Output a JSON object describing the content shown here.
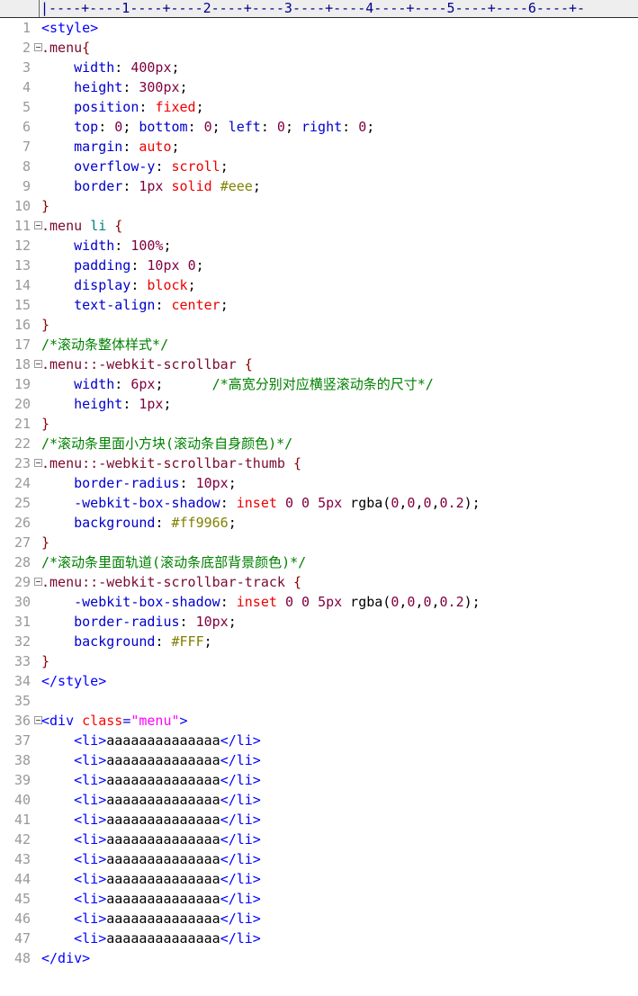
{
  "editor": {
    "type": "code-editor",
    "language": "html-css",
    "total_lines": 48,
    "font": "monospace",
    "background": "#ffffff",
    "gutter_background": "#ffffff",
    "linenumber_color": "#999999",
    "ruler_background": "#eeeeee"
  },
  "ruler": {
    "label": "column-ruler",
    "ticks": "|----+----1----+----2----+----3----+----4----+----5----+----6----+-",
    "markers": [
      "1",
      "2",
      "3",
      "4",
      "5",
      "6"
    ],
    "column_unit": 10
  },
  "colors": {
    "tag": "#0000ff",
    "attribute": "#ff0000",
    "string": "#ff00ff",
    "selector": "#7a0a2e",
    "element_selector": "#008080",
    "brace": "#8b0000",
    "property": "#0000cc",
    "keyword_value": "#ee0000",
    "number": "#800040",
    "hex_color": "#808000",
    "punctuation": "#000000",
    "comment": "#008000",
    "plain_text": "#000000"
  },
  "lines": [
    {
      "n": 1,
      "fold": false,
      "tokens": [
        {
          "c": "t-tag",
          "t": "<style>"
        }
      ]
    },
    {
      "n": 2,
      "fold": true,
      "tokens": [
        {
          "c": "t-sel",
          "t": ".menu"
        },
        {
          "c": "t-brace",
          "t": "{"
        }
      ]
    },
    {
      "n": 3,
      "fold": false,
      "tokens": [
        {
          "c": "t-text",
          "t": "    "
        },
        {
          "c": "t-prop",
          "t": "width"
        },
        {
          "c": "t-punct",
          "t": ": "
        },
        {
          "c": "t-num",
          "t": "400px"
        },
        {
          "c": "t-punct",
          "t": ";"
        }
      ]
    },
    {
      "n": 4,
      "fold": false,
      "tokens": [
        {
          "c": "t-text",
          "t": "    "
        },
        {
          "c": "t-prop",
          "t": "height"
        },
        {
          "c": "t-punct",
          "t": ": "
        },
        {
          "c": "t-num",
          "t": "300px"
        },
        {
          "c": "t-punct",
          "t": ";"
        }
      ]
    },
    {
      "n": 5,
      "fold": false,
      "tokens": [
        {
          "c": "t-text",
          "t": "    "
        },
        {
          "c": "t-prop",
          "t": "position"
        },
        {
          "c": "t-punct",
          "t": ": "
        },
        {
          "c": "t-val",
          "t": "fixed"
        },
        {
          "c": "t-punct",
          "t": ";"
        }
      ]
    },
    {
      "n": 6,
      "fold": false,
      "tokens": [
        {
          "c": "t-text",
          "t": "    "
        },
        {
          "c": "t-prop",
          "t": "top"
        },
        {
          "c": "t-punct",
          "t": ": "
        },
        {
          "c": "t-num",
          "t": "0"
        },
        {
          "c": "t-punct",
          "t": "; "
        },
        {
          "c": "t-prop",
          "t": "bottom"
        },
        {
          "c": "t-punct",
          "t": ": "
        },
        {
          "c": "t-num",
          "t": "0"
        },
        {
          "c": "t-punct",
          "t": "; "
        },
        {
          "c": "t-prop",
          "t": "left"
        },
        {
          "c": "t-punct",
          "t": ": "
        },
        {
          "c": "t-num",
          "t": "0"
        },
        {
          "c": "t-punct",
          "t": "; "
        },
        {
          "c": "t-prop",
          "t": "right"
        },
        {
          "c": "t-punct",
          "t": ": "
        },
        {
          "c": "t-num",
          "t": "0"
        },
        {
          "c": "t-punct",
          "t": ";"
        }
      ]
    },
    {
      "n": 7,
      "fold": false,
      "tokens": [
        {
          "c": "t-text",
          "t": "    "
        },
        {
          "c": "t-prop",
          "t": "margin"
        },
        {
          "c": "t-punct",
          "t": ": "
        },
        {
          "c": "t-val",
          "t": "auto"
        },
        {
          "c": "t-punct",
          "t": ";"
        }
      ]
    },
    {
      "n": 8,
      "fold": false,
      "tokens": [
        {
          "c": "t-text",
          "t": "    "
        },
        {
          "c": "t-prop",
          "t": "overflow-y"
        },
        {
          "c": "t-punct",
          "t": ": "
        },
        {
          "c": "t-val",
          "t": "scroll"
        },
        {
          "c": "t-punct",
          "t": ";"
        }
      ]
    },
    {
      "n": 9,
      "fold": false,
      "tokens": [
        {
          "c": "t-text",
          "t": "    "
        },
        {
          "c": "t-prop",
          "t": "border"
        },
        {
          "c": "t-punct",
          "t": ": "
        },
        {
          "c": "t-num",
          "t": "1px"
        },
        {
          "c": "t-punct",
          "t": " "
        },
        {
          "c": "t-val",
          "t": "solid"
        },
        {
          "c": "t-punct",
          "t": " "
        },
        {
          "c": "t-hex",
          "t": "#eee"
        },
        {
          "c": "t-punct",
          "t": ";"
        }
      ]
    },
    {
      "n": 10,
      "fold": false,
      "tokens": [
        {
          "c": "t-brace",
          "t": "}"
        }
      ]
    },
    {
      "n": 11,
      "fold": true,
      "tokens": [
        {
          "c": "t-sel",
          "t": ".menu"
        },
        {
          "c": "t-punct",
          "t": " "
        },
        {
          "c": "t-elem",
          "t": "li"
        },
        {
          "c": "t-punct",
          "t": " "
        },
        {
          "c": "t-brace",
          "t": "{"
        }
      ]
    },
    {
      "n": 12,
      "fold": false,
      "tokens": [
        {
          "c": "t-text",
          "t": "    "
        },
        {
          "c": "t-prop",
          "t": "width"
        },
        {
          "c": "t-punct",
          "t": ": "
        },
        {
          "c": "t-num",
          "t": "100%"
        },
        {
          "c": "t-punct",
          "t": ";"
        }
      ]
    },
    {
      "n": 13,
      "fold": false,
      "tokens": [
        {
          "c": "t-text",
          "t": "    "
        },
        {
          "c": "t-prop",
          "t": "padding"
        },
        {
          "c": "t-punct",
          "t": ": "
        },
        {
          "c": "t-num",
          "t": "10px"
        },
        {
          "c": "t-punct",
          "t": " "
        },
        {
          "c": "t-num",
          "t": "0"
        },
        {
          "c": "t-punct",
          "t": ";"
        }
      ]
    },
    {
      "n": 14,
      "fold": false,
      "tokens": [
        {
          "c": "t-text",
          "t": "    "
        },
        {
          "c": "t-prop",
          "t": "display"
        },
        {
          "c": "t-punct",
          "t": ": "
        },
        {
          "c": "t-val",
          "t": "block"
        },
        {
          "c": "t-punct",
          "t": ";"
        }
      ]
    },
    {
      "n": 15,
      "fold": false,
      "tokens": [
        {
          "c": "t-text",
          "t": "    "
        },
        {
          "c": "t-prop",
          "t": "text-align"
        },
        {
          "c": "t-punct",
          "t": ": "
        },
        {
          "c": "t-val",
          "t": "center"
        },
        {
          "c": "t-punct",
          "t": ";"
        }
      ]
    },
    {
      "n": 16,
      "fold": false,
      "tokens": [
        {
          "c": "t-brace",
          "t": "}"
        }
      ]
    },
    {
      "n": 17,
      "fold": false,
      "tokens": [
        {
          "c": "t-comment",
          "t": "/*滚动条整体样式*/"
        }
      ]
    },
    {
      "n": 18,
      "fold": true,
      "tokens": [
        {
          "c": "t-sel",
          "t": ".menu::-webkit-scrollbar"
        },
        {
          "c": "t-punct",
          "t": " "
        },
        {
          "c": "t-brace",
          "t": "{"
        }
      ]
    },
    {
      "n": 19,
      "fold": false,
      "tokens": [
        {
          "c": "t-text",
          "t": "    "
        },
        {
          "c": "t-prop",
          "t": "width"
        },
        {
          "c": "t-punct",
          "t": ": "
        },
        {
          "c": "t-num",
          "t": "6px"
        },
        {
          "c": "t-punct",
          "t": ";"
        },
        {
          "c": "t-text",
          "t": "      "
        },
        {
          "c": "t-comment",
          "t": "/*高宽分别对应横竖滚动条的尺寸*/"
        }
      ]
    },
    {
      "n": 20,
      "fold": false,
      "tokens": [
        {
          "c": "t-text",
          "t": "    "
        },
        {
          "c": "t-prop",
          "t": "height"
        },
        {
          "c": "t-punct",
          "t": ": "
        },
        {
          "c": "t-num",
          "t": "1px"
        },
        {
          "c": "t-punct",
          "t": ";"
        }
      ]
    },
    {
      "n": 21,
      "fold": false,
      "tokens": [
        {
          "c": "t-brace",
          "t": "}"
        }
      ]
    },
    {
      "n": 22,
      "fold": false,
      "tokens": [
        {
          "c": "t-comment",
          "t": "/*滚动条里面小方块(滚动条自身颜色)*/"
        }
      ]
    },
    {
      "n": 23,
      "fold": true,
      "tokens": [
        {
          "c": "t-sel",
          "t": ".menu::-webkit-scrollbar-thumb"
        },
        {
          "c": "t-punct",
          "t": " "
        },
        {
          "c": "t-brace",
          "t": "{"
        }
      ]
    },
    {
      "n": 24,
      "fold": false,
      "tokens": [
        {
          "c": "t-text",
          "t": "    "
        },
        {
          "c": "t-prop",
          "t": "border-radius"
        },
        {
          "c": "t-punct",
          "t": ": "
        },
        {
          "c": "t-num",
          "t": "10px"
        },
        {
          "c": "t-punct",
          "t": ";"
        }
      ]
    },
    {
      "n": 25,
      "fold": false,
      "tokens": [
        {
          "c": "t-text",
          "t": "    "
        },
        {
          "c": "t-prop",
          "t": "-webkit-box-shadow"
        },
        {
          "c": "t-punct",
          "t": ": "
        },
        {
          "c": "t-val",
          "t": "inset"
        },
        {
          "c": "t-punct",
          "t": " "
        },
        {
          "c": "t-num",
          "t": "0"
        },
        {
          "c": "t-punct",
          "t": " "
        },
        {
          "c": "t-num",
          "t": "0"
        },
        {
          "c": "t-punct",
          "t": " "
        },
        {
          "c": "t-num",
          "t": "5px"
        },
        {
          "c": "t-punct",
          "t": " rgba("
        },
        {
          "c": "t-num",
          "t": "0"
        },
        {
          "c": "t-punct",
          "t": ","
        },
        {
          "c": "t-num",
          "t": "0"
        },
        {
          "c": "t-punct",
          "t": ","
        },
        {
          "c": "t-num",
          "t": "0"
        },
        {
          "c": "t-punct",
          "t": ","
        },
        {
          "c": "t-num",
          "t": "0.2"
        },
        {
          "c": "t-punct",
          "t": ");"
        }
      ]
    },
    {
      "n": 26,
      "fold": false,
      "tokens": [
        {
          "c": "t-text",
          "t": "    "
        },
        {
          "c": "t-prop",
          "t": "background"
        },
        {
          "c": "t-punct",
          "t": ": "
        },
        {
          "c": "t-hex",
          "t": "#ff9966"
        },
        {
          "c": "t-punct",
          "t": ";"
        }
      ]
    },
    {
      "n": 27,
      "fold": false,
      "tokens": [
        {
          "c": "t-brace",
          "t": "}"
        }
      ]
    },
    {
      "n": 28,
      "fold": false,
      "tokens": [
        {
          "c": "t-comment",
          "t": "/*滚动条里面轨道(滚动条底部背景颜色)*/"
        }
      ]
    },
    {
      "n": 29,
      "fold": true,
      "tokens": [
        {
          "c": "t-sel",
          "t": ".menu::-webkit-scrollbar-track"
        },
        {
          "c": "t-punct",
          "t": " "
        },
        {
          "c": "t-brace",
          "t": "{"
        }
      ]
    },
    {
      "n": 30,
      "fold": false,
      "tokens": [
        {
          "c": "t-text",
          "t": "    "
        },
        {
          "c": "t-prop",
          "t": "-webkit-box-shadow"
        },
        {
          "c": "t-punct",
          "t": ": "
        },
        {
          "c": "t-val",
          "t": "inset"
        },
        {
          "c": "t-punct",
          "t": " "
        },
        {
          "c": "t-num",
          "t": "0"
        },
        {
          "c": "t-punct",
          "t": " "
        },
        {
          "c": "t-num",
          "t": "0"
        },
        {
          "c": "t-punct",
          "t": " "
        },
        {
          "c": "t-num",
          "t": "5px"
        },
        {
          "c": "t-punct",
          "t": " rgba("
        },
        {
          "c": "t-num",
          "t": "0"
        },
        {
          "c": "t-punct",
          "t": ","
        },
        {
          "c": "t-num",
          "t": "0"
        },
        {
          "c": "t-punct",
          "t": ","
        },
        {
          "c": "t-num",
          "t": "0"
        },
        {
          "c": "t-punct",
          "t": ","
        },
        {
          "c": "t-num",
          "t": "0.2"
        },
        {
          "c": "t-punct",
          "t": ");"
        }
      ]
    },
    {
      "n": 31,
      "fold": false,
      "tokens": [
        {
          "c": "t-text",
          "t": "    "
        },
        {
          "c": "t-prop",
          "t": "border-radius"
        },
        {
          "c": "t-punct",
          "t": ": "
        },
        {
          "c": "t-num",
          "t": "10px"
        },
        {
          "c": "t-punct",
          "t": ";"
        }
      ]
    },
    {
      "n": 32,
      "fold": false,
      "tokens": [
        {
          "c": "t-text",
          "t": "    "
        },
        {
          "c": "t-prop",
          "t": "background"
        },
        {
          "c": "t-punct",
          "t": ": "
        },
        {
          "c": "t-hex",
          "t": "#FFF"
        },
        {
          "c": "t-punct",
          "t": ";"
        }
      ]
    },
    {
      "n": 33,
      "fold": false,
      "tokens": [
        {
          "c": "t-brace",
          "t": "}"
        }
      ]
    },
    {
      "n": 34,
      "fold": false,
      "tokens": [
        {
          "c": "t-tag",
          "t": "</style>"
        }
      ]
    },
    {
      "n": 35,
      "fold": false,
      "tokens": []
    },
    {
      "n": 36,
      "fold": true,
      "tokens": [
        {
          "c": "t-tag",
          "t": "<div "
        },
        {
          "c": "t-attr",
          "t": "class"
        },
        {
          "c": "t-tag",
          "t": "="
        },
        {
          "c": "t-str",
          "t": "\"menu\""
        },
        {
          "c": "t-tag",
          "t": ">"
        }
      ]
    },
    {
      "n": 37,
      "fold": false,
      "tokens": [
        {
          "c": "t-text",
          "t": "    "
        },
        {
          "c": "t-tag",
          "t": "<li>"
        },
        {
          "c": "t-text",
          "t": "aaaaaaaaaaaaaa"
        },
        {
          "c": "t-tag",
          "t": "</li>"
        }
      ]
    },
    {
      "n": 38,
      "fold": false,
      "tokens": [
        {
          "c": "t-text",
          "t": "    "
        },
        {
          "c": "t-tag",
          "t": "<li>"
        },
        {
          "c": "t-text",
          "t": "aaaaaaaaaaaaaa"
        },
        {
          "c": "t-tag",
          "t": "</li>"
        }
      ]
    },
    {
      "n": 39,
      "fold": false,
      "tokens": [
        {
          "c": "t-text",
          "t": "    "
        },
        {
          "c": "t-tag",
          "t": "<li>"
        },
        {
          "c": "t-text",
          "t": "aaaaaaaaaaaaaa"
        },
        {
          "c": "t-tag",
          "t": "</li>"
        }
      ]
    },
    {
      "n": 40,
      "fold": false,
      "tokens": [
        {
          "c": "t-text",
          "t": "    "
        },
        {
          "c": "t-tag",
          "t": "<li>"
        },
        {
          "c": "t-text",
          "t": "aaaaaaaaaaaaaa"
        },
        {
          "c": "t-tag",
          "t": "</li>"
        }
      ]
    },
    {
      "n": 41,
      "fold": false,
      "tokens": [
        {
          "c": "t-text",
          "t": "    "
        },
        {
          "c": "t-tag",
          "t": "<li>"
        },
        {
          "c": "t-text",
          "t": "aaaaaaaaaaaaaa"
        },
        {
          "c": "t-tag",
          "t": "</li>"
        }
      ]
    },
    {
      "n": 42,
      "fold": false,
      "tokens": [
        {
          "c": "t-text",
          "t": "    "
        },
        {
          "c": "t-tag",
          "t": "<li>"
        },
        {
          "c": "t-text",
          "t": "aaaaaaaaaaaaaa"
        },
        {
          "c": "t-tag",
          "t": "</li>"
        }
      ]
    },
    {
      "n": 43,
      "fold": false,
      "tokens": [
        {
          "c": "t-text",
          "t": "    "
        },
        {
          "c": "t-tag",
          "t": "<li>"
        },
        {
          "c": "t-text",
          "t": "aaaaaaaaaaaaaa"
        },
        {
          "c": "t-tag",
          "t": "</li>"
        }
      ]
    },
    {
      "n": 44,
      "fold": false,
      "tokens": [
        {
          "c": "t-text",
          "t": "    "
        },
        {
          "c": "t-tag",
          "t": "<li>"
        },
        {
          "c": "t-text",
          "t": "aaaaaaaaaaaaaa"
        },
        {
          "c": "t-tag",
          "t": "</li>"
        }
      ]
    },
    {
      "n": 45,
      "fold": false,
      "tokens": [
        {
          "c": "t-text",
          "t": "    "
        },
        {
          "c": "t-tag",
          "t": "<li>"
        },
        {
          "c": "t-text",
          "t": "aaaaaaaaaaaaaa"
        },
        {
          "c": "t-tag",
          "t": "</li>"
        }
      ]
    },
    {
      "n": 46,
      "fold": false,
      "tokens": [
        {
          "c": "t-text",
          "t": "    "
        },
        {
          "c": "t-tag",
          "t": "<li>"
        },
        {
          "c": "t-text",
          "t": "aaaaaaaaaaaaaa"
        },
        {
          "c": "t-tag",
          "t": "</li>"
        }
      ]
    },
    {
      "n": 47,
      "fold": false,
      "tokens": [
        {
          "c": "t-text",
          "t": "    "
        },
        {
          "c": "t-tag",
          "t": "<li>"
        },
        {
          "c": "t-text",
          "t": "aaaaaaaaaaaaaa"
        },
        {
          "c": "t-tag",
          "t": "</li>"
        }
      ]
    },
    {
      "n": 48,
      "fold": false,
      "tokens": [
        {
          "c": "t-tag",
          "t": "</div>"
        }
      ]
    }
  ]
}
